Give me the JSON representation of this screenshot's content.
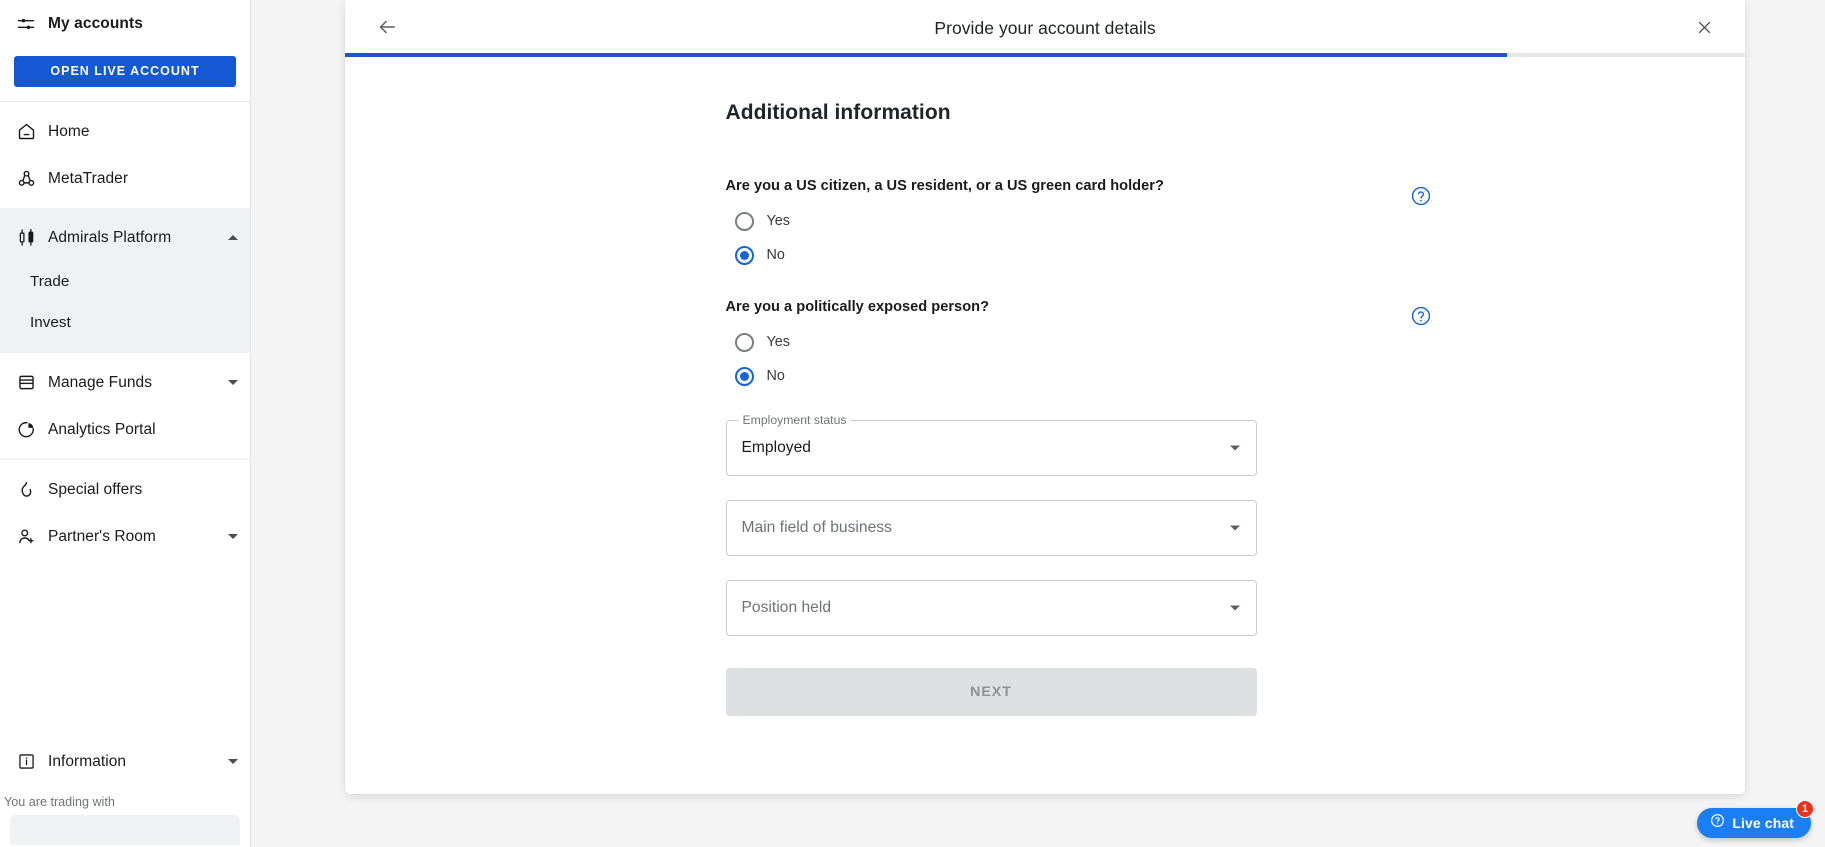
{
  "sidebar": {
    "accounts": {
      "label": "My accounts",
      "icon": "sliders-icon"
    },
    "cta": {
      "label": "OPEN LIVE ACCOUNT",
      "color": "#1558d6"
    },
    "group1": [
      {
        "label": "Home",
        "icon": "home-icon",
        "expandable": false
      },
      {
        "label": "MetaTrader",
        "icon": "metatrader-icon",
        "expandable": false
      }
    ],
    "active_group": {
      "label": "Admirals Platform",
      "icon": "candlestick-icon",
      "caret": "chevron-up-icon",
      "sub_items": [
        {
          "label": "Trade"
        },
        {
          "label": "Invest"
        }
      ]
    },
    "group2": [
      {
        "label": "Manage Funds",
        "icon": "wallet-icon",
        "caret": "chevron-down-icon",
        "expandable": true
      },
      {
        "label": "Analytics Portal",
        "icon": "pie-chart-icon",
        "expandable": false
      }
    ],
    "group3": [
      {
        "label": "Special offers",
        "icon": "flame-icon",
        "expandable": false
      },
      {
        "label": "Partner's Room",
        "icon": "user-plus-icon",
        "caret": "chevron-down-icon",
        "expandable": true
      }
    ],
    "bottom": [
      {
        "label": "Information",
        "icon": "info-square-icon",
        "caret": "chevron-down-icon",
        "expandable": true
      }
    ],
    "trading_note": "You are trading with"
  },
  "modal": {
    "title": "Provide your account details",
    "back_icon": "arrow-left-icon",
    "close_icon": "close-icon",
    "progress_percent": 83,
    "progress_color": "#1558d6",
    "section_title": "Additional information",
    "questions": [
      {
        "label": "Are you a US citizen, a US resident, or a US green card holder?",
        "help_icon": "help-circle-icon",
        "options": [
          {
            "label": "Yes",
            "checked": false
          },
          {
            "label": "No",
            "checked": true
          }
        ]
      },
      {
        "label": "Are you a politically exposed person?",
        "help_icon": "help-circle-icon",
        "options": [
          {
            "label": "Yes",
            "checked": false
          },
          {
            "label": "No",
            "checked": true
          }
        ]
      }
    ],
    "fields": [
      {
        "legend": "Employment status",
        "value": "Employed",
        "placeholder": "",
        "arrow_icon": "chevron-down-icon"
      },
      {
        "legend": "",
        "value": "",
        "placeholder": "Main field of business",
        "arrow_icon": "chevron-down-icon"
      },
      {
        "legend": "",
        "value": "",
        "placeholder": "Position held",
        "arrow_icon": "chevron-down-icon"
      }
    ],
    "next_label": "NEXT"
  },
  "livechat": {
    "label": "Live chat",
    "icon": "help-circle-icon",
    "badge": "1",
    "color": "#1a7ef5",
    "badge_color": "#e8341c"
  }
}
